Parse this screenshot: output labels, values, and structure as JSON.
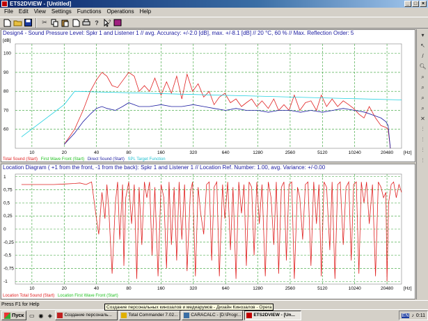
{
  "window": {
    "title": "ETS2DVIEW - [Untitled]"
  },
  "menu": [
    "File",
    "Edit",
    "View",
    "Settings",
    "Functions",
    "Operations",
    "Help"
  ],
  "top_chart": {
    "title": "Design4 - Sound Pressure Level:  Spkr 1  and Listener 1 // avg. Accuracy: +/-2.0 [dB], max. +/-8.1 [dB] // 20 °C, 60 % // Max. Reflection Order: 5",
    "y_unit": "[dB]",
    "x_unit": "[Hz]",
    "legend": [
      {
        "label": "Total Sound (Start)",
        "color": "#e02020"
      },
      {
        "label": "First Wave Front (Start)",
        "color": "#20c020"
      },
      {
        "label": "Direct Sound (Start)",
        "color": "#1a1aa0"
      },
      {
        "label": "SPL Target Function",
        "color": "#20d0e0"
      }
    ]
  },
  "bottom_chart": {
    "title": "Location Diagram ( +1 from the front, -1 from the back):  Spkr 1  and Listener 1 // Location Ref. Number: 1.00, avg. Variance: +/-0.00",
    "x_unit": "[Hz]",
    "legend": [
      {
        "label": "Location Total Sound (Start)",
        "color": "#e02020"
      },
      {
        "label": "Location First Wave Front (Start)",
        "color": "#20c020"
      }
    ]
  },
  "chart_data": [
    {
      "type": "line",
      "x_scale": "log",
      "x_ticks": [
        "10",
        "20",
        "40",
        "80",
        "160",
        "320",
        "640",
        "1280",
        "2560",
        "5120",
        "10240",
        "20480"
      ],
      "y_ticks": [
        "100",
        "90",
        "80",
        "70",
        "60"
      ],
      "ylim": [
        50,
        105
      ],
      "xlim": [
        7,
        28000
      ],
      "ylabel": "[dB]",
      "xlabel": "[Hz]",
      "grid": true,
      "series": [
        {
          "name": "Total Sound (Start)",
          "color": "#e02020",
          "x": [
            20,
            25,
            30,
            35,
            40,
            45,
            50,
            56,
            63,
            71,
            80,
            90,
            100,
            112,
            125,
            140,
            160,
            180,
            200,
            224,
            250,
            280,
            315,
            355,
            400,
            450,
            500,
            560,
            630,
            710,
            800,
            900,
            1000,
            1120,
            1250,
            1400,
            1600,
            1800,
            2000,
            2240,
            2500,
            2800,
            3150,
            3550,
            4000,
            4500,
            5000,
            5600,
            6300,
            7100,
            8000,
            9000,
            10000,
            11200,
            12500,
            14000,
            16000,
            18000,
            20000,
            21000,
            22000
          ],
          "y": [
            52,
            60,
            70,
            80,
            86,
            90,
            88,
            83,
            82,
            86,
            90,
            88,
            80,
            83,
            80,
            87,
            78,
            85,
            79,
            88,
            76,
            89,
            80,
            84,
            77,
            80,
            73,
            77,
            79,
            74,
            76,
            72,
            74,
            76,
            72,
            75,
            71,
            76,
            70,
            73,
            70,
            78,
            70,
            74,
            75,
            70,
            78,
            72,
            76,
            72,
            75,
            73,
            71,
            68,
            66,
            72,
            66,
            62,
            61,
            60,
            40
          ]
        },
        {
          "name": "Direct Sound (Start)",
          "color": "#1a1aa0",
          "x": [
            20,
            25,
            30,
            35,
            40,
            45,
            50,
            60,
            70,
            80,
            100,
            125,
            160,
            200,
            250,
            320,
            400,
            500,
            640,
            800,
            1000,
            1280,
            1600,
            2000,
            2560,
            3200,
            4000,
            5120,
            6400,
            8000,
            10240,
            12800,
            16000,
            18000,
            20000,
            21000,
            22000
          ],
          "y": [
            52,
            58,
            64,
            68,
            71,
            72,
            71,
            70,
            72,
            74,
            72,
            72,
            73,
            72,
            72,
            73,
            72,
            71,
            70,
            71,
            70,
            70,
            69,
            70,
            70,
            69,
            70,
            69,
            70,
            71,
            70,
            69,
            67,
            66,
            64,
            62,
            46
          ]
        },
        {
          "name": "SPL Target Function",
          "color": "#20d0e0",
          "x": [
            8,
            20,
            25,
            28000
          ],
          "y": [
            56,
            73,
            80,
            75.5
          ]
        }
      ]
    },
    {
      "type": "line",
      "x_scale": "log",
      "x_ticks": [
        "10",
        "20",
        "40",
        "80",
        "160",
        "320",
        "640",
        "1280",
        "2560",
        "5120",
        "10240",
        "20480"
      ],
      "y_ticks": [
        "1",
        "0.75",
        "0.5",
        "0.25",
        "0",
        "-0.25",
        "-0.5",
        "-0.75",
        "-1"
      ],
      "ylim": [
        -1.05,
        1.05
      ],
      "xlim": [
        7,
        28000
      ],
      "xlabel": "[Hz]",
      "grid": true,
      "series": [
        {
          "name": "Location Total Sound (Start)",
          "color": "#e02020",
          "x": [
            8,
            12,
            16,
            20,
            25,
            28,
            32,
            36,
            40,
            42,
            45,
            48,
            50,
            52,
            56,
            60,
            63,
            66,
            70,
            72,
            75,
            80,
            85,
            90,
            95,
            100,
            106,
            112,
            118,
            125,
            132,
            140,
            150,
            160,
            170,
            180,
            190,
            200,
            212,
            224,
            236,
            250,
            265,
            280,
            300,
            315,
            335,
            355,
            375,
            400,
            425,
            450,
            475,
            500,
            530,
            560,
            600,
            630,
            670,
            710,
            750,
            800,
            850,
            900,
            950,
            1000,
            1060,
            1120,
            1180,
            1250,
            1320,
            1400,
            1500,
            1600,
            1700,
            1800,
            1900,
            2000,
            2120,
            2240,
            2360,
            2500,
            2650,
            2800,
            3000,
            3150,
            3350,
            3550,
            3750,
            4000,
            4250,
            4500,
            4750,
            5000,
            5300,
            5600,
            6000,
            6300,
            6700,
            7100,
            7500,
            8000,
            8500,
            9000,
            9500,
            10000,
            10600,
            11200,
            11800,
            12500,
            13200,
            14000,
            15000,
            16000,
            17000,
            18000,
            19000,
            20000,
            20480,
            21200,
            22400,
            23600,
            25000,
            26500,
            28000
          ],
          "y": [
            0.85,
            0.85,
            0.85,
            0.86,
            0.87,
            0.88,
            0.85,
            0.9,
            0.2,
            -0.1,
            0.7,
            0.2,
            0.85,
            0.4,
            -0.85,
            0.5,
            0.9,
            -0.2,
            0.85,
            -0.7,
            0.6,
            0.9,
            0.1,
            0.85,
            -0.95,
            0.8,
            -0.3,
            0.9,
            0.6,
            0.9,
            -0.5,
            0.8,
            -0.9,
            0.85,
            0.6,
            -0.75,
            0.9,
            -0.3,
            0.8,
            -0.6,
            0.9,
            -0.2,
            0.85,
            -0.8,
            0.7,
            0.9,
            -0.9,
            0.8,
            0.3,
            -0.1,
            0.85,
            0.9,
            -0.6,
            0.8,
            0.9,
            -0.9,
            0.85,
            0.2,
            0.9,
            -0.4,
            0.8,
            -0.95,
            0.9,
            0.3,
            0.85,
            -0.7,
            0.9,
            0.8,
            -0.5,
            0.9,
            0.1,
            0.85,
            -0.9,
            0.9,
            0.6,
            -0.3,
            0.9,
            -0.85,
            0.8,
            0.9,
            -0.6,
            0.85,
            0.9,
            -0.95,
            0.8,
            0.6,
            -0.2,
            0.85,
            0.9,
            -0.7,
            0.9,
            0.1,
            0.85,
            -0.9,
            0.9,
            0.8,
            -0.4,
            0.9,
            -0.95,
            0.85,
            0.9,
            -0.3,
            0.8,
            0.9,
            -0.6,
            0.85,
            0.9,
            -0.85,
            0.9,
            0.5,
            0.9,
            0.1,
            0.85,
            -0.9,
            0.9,
            0.8,
            0.6,
            0.7,
            -1.0,
            0.5,
            0.85,
            0.9,
            0.6,
            0.85,
            0.7
          ]
        }
      ]
    }
  ],
  "right_tools": [
    "select-icon",
    "pointer-icon",
    "pencil-icon",
    "zoom-icon",
    "zoom-x-icon",
    "zoom-y-icon",
    "zoom-out-icon",
    "zoom-fit-icon",
    "cross-icon",
    "marker1-icon",
    "marker2-icon",
    "marker3-icon",
    "marker4-icon"
  ],
  "status": {
    "text": "Press F1 for Help"
  },
  "tooltip": {
    "text": "Создание персональных кинозалов и медиарумов - Дизайн Кинозалов - Opera"
  },
  "taskbar": {
    "start_label": "Пуск",
    "tasks": [
      {
        "label": "Создание персональ...",
        "active": false
      },
      {
        "label": "Total Commander 7.02...",
        "active": false
      },
      {
        "label": "CARACALC - [D:\\Progr...",
        "active": false
      },
      {
        "label": "ETS2DVIEW - [Un...",
        "active": true
      }
    ],
    "tray_lang": "EN",
    "clock": "0:11"
  }
}
